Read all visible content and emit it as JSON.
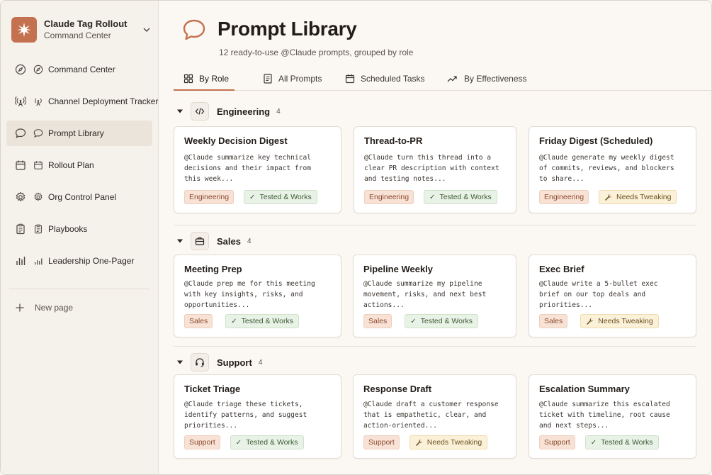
{
  "workspace": {
    "name": "Claude Tag Rollout",
    "subtitle": "Command Center"
  },
  "sidebar": {
    "items": [
      {
        "label": "Command Center",
        "icon": "compass-icon"
      },
      {
        "label": "Channel Deployment Tracker",
        "icon": "broadcast-icon"
      },
      {
        "label": "Prompt Library",
        "icon": "chat-bubble-icon"
      },
      {
        "label": "Rollout Plan",
        "icon": "calendar-icon"
      },
      {
        "label": "Org Control Panel",
        "icon": "gear-icon"
      },
      {
        "label": "Playbooks",
        "icon": "clipboard-icon"
      },
      {
        "label": "Leadership One-Pager",
        "icon": "bar-chart-icon"
      }
    ],
    "new_page": "New page",
    "active_index": 2
  },
  "header": {
    "title": "Prompt Library",
    "subtitle": "12 ready-to-use @Claude prompts, grouped by role"
  },
  "tabs": [
    {
      "label": "By Role",
      "icon": "grid-icon"
    },
    {
      "label": "All Prompts",
      "icon": "document-icon"
    },
    {
      "label": "Scheduled Tasks",
      "icon": "calendar-icon"
    },
    {
      "label": "By Effectiveness",
      "icon": "trend-icon"
    }
  ],
  "sections": [
    {
      "title": "Engineering",
      "count": "4",
      "icon": "code-icon",
      "cards": [
        {
          "title": "Weekly Decision Digest",
          "text": "@Claude summarize key technical\ndecisions and their impact from\nthis week...",
          "role": "Engineering",
          "status": "Tested & Works",
          "status_type": "tested"
        },
        {
          "title": "Thread-to-PR",
          "text": "@Claude turn this thread into a\nclear PR description with context\nand testing notes...",
          "role": "Engineering",
          "status": "Tested & Works",
          "status_type": "tested"
        },
        {
          "title": "Friday Digest (Scheduled)",
          "text": "@Claude generate my weekly digest\nof commits, reviews, and blockers\nto share...",
          "role": "Engineering",
          "status": "Needs Tweaking",
          "status_type": "tweak"
        }
      ]
    },
    {
      "title": "Sales",
      "count": "4",
      "icon": "briefcase-icon",
      "cards": [
        {
          "title": "Meeting Prep",
          "text": "@Claude prep me for this meeting\nwith key insights, risks, and\nopportunities...",
          "role": "Sales",
          "status": "Tested & Works",
          "status_type": "tested"
        },
        {
          "title": "Pipeline Weekly",
          "text": "@Claude summarize my pipeline\nmovement, risks, and next best\nactions...",
          "role": "Sales",
          "status": "Tested & Works",
          "status_type": "tested"
        },
        {
          "title": "Exec Brief",
          "text": "@Claude write a 5-bullet exec\nbrief on our top deals and\npriorities...",
          "role": "Sales",
          "status": "Needs Tweaking",
          "status_type": "tweak"
        }
      ]
    },
    {
      "title": "Support",
      "count": "4",
      "icon": "headset-icon",
      "cards": [
        {
          "title": "Ticket Triage",
          "text": "@Claude triage these tickets,\nidentify patterns, and suggest\npriorities...",
          "role": "Support",
          "status": "Tested & Works",
          "status_type": "tested"
        },
        {
          "title": "Response Draft",
          "text": "@Claude draft a customer response\nthat is empathetic, clear, and\naction-oriented...",
          "role": "Support",
          "status": "Needs Tweaking",
          "status_type": "tweak"
        },
        {
          "title": "Escalation Summary",
          "text": "@Claude summarize this escalated\nticket with timeline, root cause\nand next steps...",
          "role": "Support",
          "status": "Tested & Works",
          "status_type": "tested"
        }
      ]
    }
  ],
  "colors": {
    "accent": "#c4714f",
    "tested_bg": "#e9f2e6",
    "tweak_bg": "#fbf0d8",
    "role_bg": "#f8e2d6"
  },
  "glyphs": {
    "check": "✓",
    "wrench": "🔧"
  }
}
